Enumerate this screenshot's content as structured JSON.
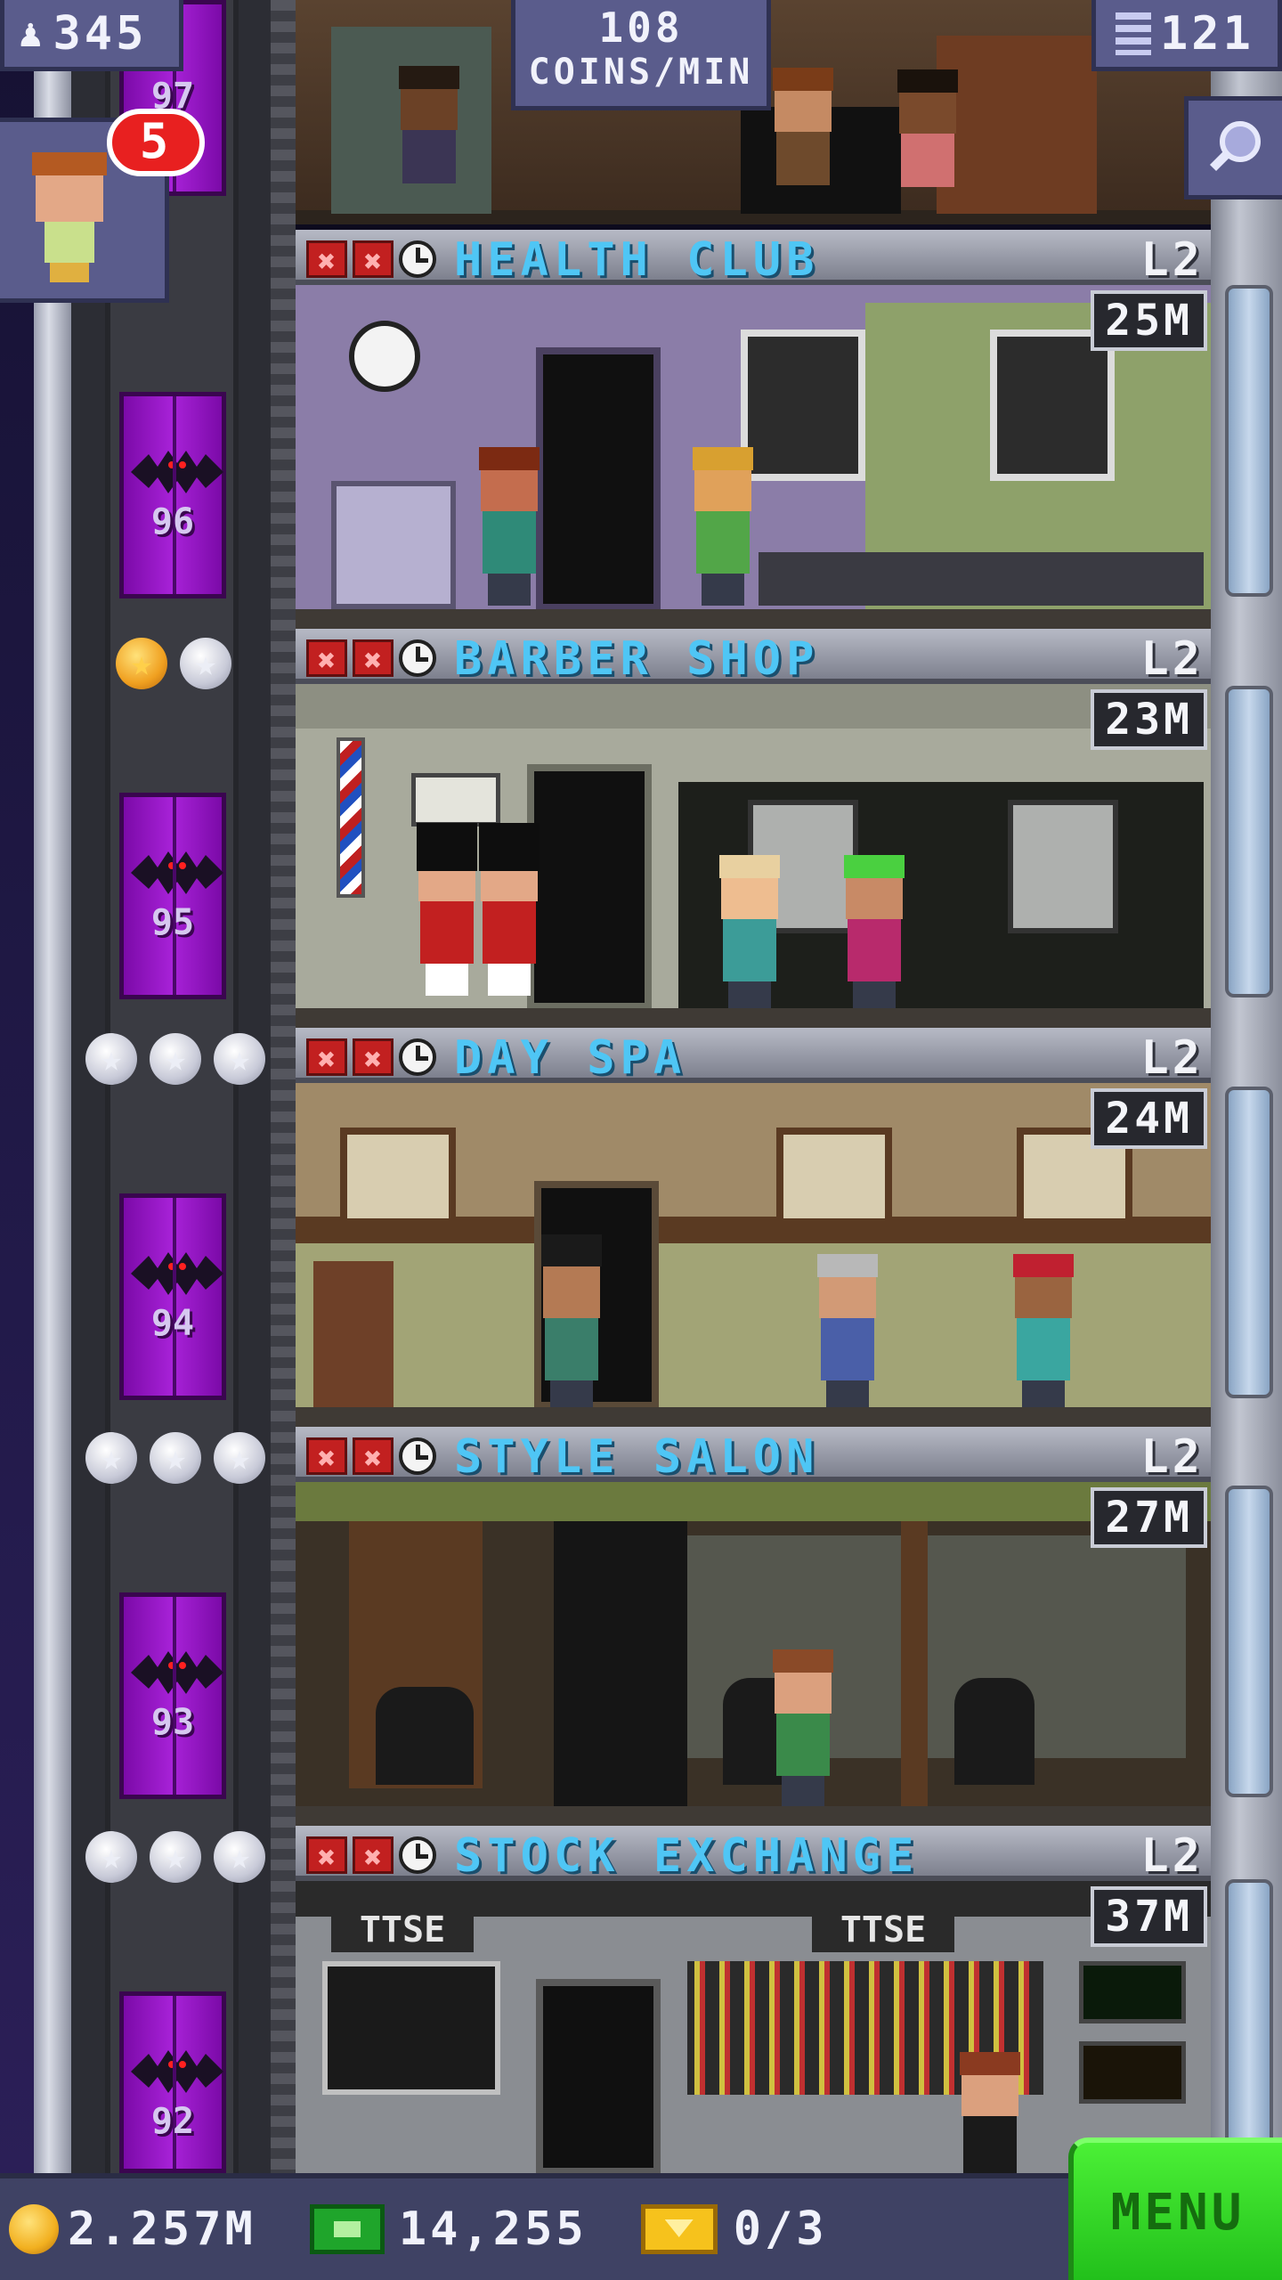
{
  "hud": {
    "population": "345",
    "coins_per_min_value": "108",
    "coins_per_min_unit": "COINS/MIN",
    "floors": "121",
    "visitor_badge": "5"
  },
  "floors": [
    {
      "name": "HEALTH CLUB",
      "level": "L2",
      "cost": "25M",
      "elevator_floor": "96",
      "stars": []
    },
    {
      "name": "BARBER SHOP",
      "level": "L2",
      "cost": "23M",
      "elevator_floor": "95",
      "stars": [
        "gold",
        "silver"
      ]
    },
    {
      "name": "DAY SPA",
      "level": "L2",
      "cost": "24M",
      "elevator_floor": "94",
      "stars": [
        "silver",
        "silver",
        "silver"
      ]
    },
    {
      "name": "STYLE SALON",
      "level": "L2",
      "cost": "27M",
      "elevator_floor": "93",
      "stars": [
        "silver",
        "silver",
        "silver"
      ]
    },
    {
      "name": "STOCK EXCHANGE",
      "level": "L2",
      "cost": "37M",
      "elevator_floor": "92",
      "stars": [
        "silver",
        "silver",
        "silver"
      ]
    }
  ],
  "partial_top_floor": "97",
  "room_signs": {
    "stock_exchange_sign_1": "TTSE",
    "stock_exchange_sign_2": "TTSE"
  },
  "bottom": {
    "coins": "2.257M",
    "bux": "14,255",
    "tickets": "0/3",
    "menu_label": "MENU"
  },
  "colors": {
    "floor_name": "#4fc6f5",
    "elevator_door": "#a822d8",
    "menu_button": "#3ee02a",
    "hud_panel": "#5a5c8c"
  }
}
